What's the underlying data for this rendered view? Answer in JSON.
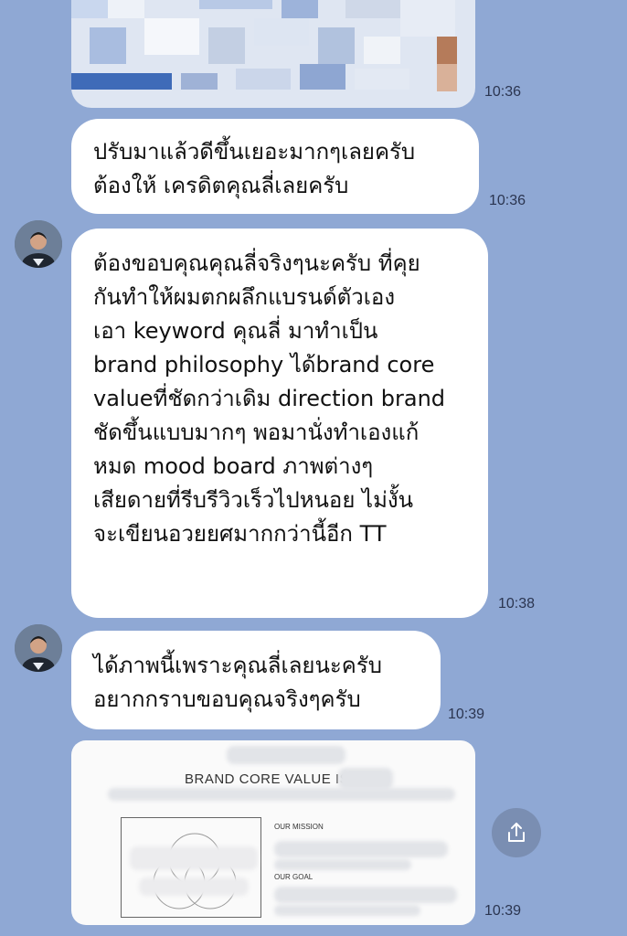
{
  "chat": {
    "messages": [
      {
        "id": "m1",
        "type": "image",
        "time": "10:36"
      },
      {
        "id": "m2",
        "type": "text",
        "sender": "me",
        "text": "ปรับมาแล้วดีขึ้นเยอะมากๆเลยครับ\nต้องให้ เครดิตคุณลี่เลยครับ",
        "time": "10:36"
      },
      {
        "id": "m3",
        "type": "text",
        "sender": "contact",
        "text": "ต้องขอบคุณคุณลี่จริงๆนะครับ ที่คุย\nกันทำให้ผมตกผลึกแบรนด์ตัวเอง\nเอา keyword คุณลี่ มาทำเป็น\nbrand philosophy ได้brand core\nvalueที่ชัดกว่าเดิม direction brand\nชัดขึ้นแบบมากๆ พอมานั่งทำเองแก้\nหมด mood board ภาพต่างๆ\nเสียดายที่รีบรีวิวเร็วไปหนอย ไม่งั้น\nจะเขียนอวยยศมากกว่านี้อีก TT",
        "time": "10:38"
      },
      {
        "id": "m4",
        "type": "text",
        "sender": "contact",
        "text": "ได้ภาพนี้เพราะคุณลี่เลยนะครับ\nอยากกราบขอบคุณจริงๆครับ",
        "time": "10:39"
      },
      {
        "id": "m5",
        "type": "image",
        "time": "10:39",
        "title": "BRAND CORE VALUE IS",
        "sections": [
          "OUR MISSION",
          "OUR GOAL"
        ]
      }
    ]
  },
  "icons": {
    "share": "share-icon",
    "avatar": "contact-avatar"
  },
  "colors": {
    "background": "#8fa8d4",
    "bubble": "#ffffff"
  }
}
